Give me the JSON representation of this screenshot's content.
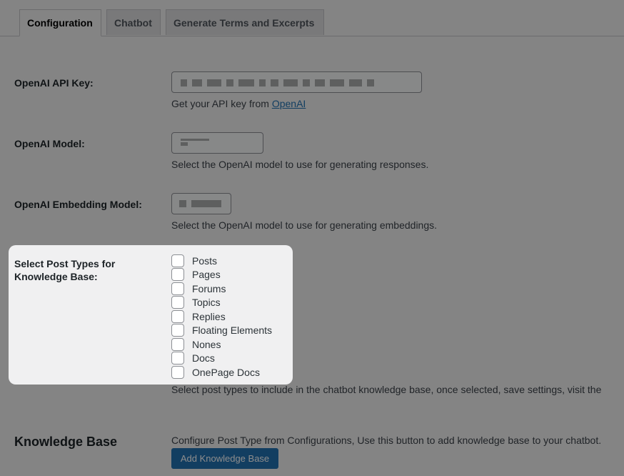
{
  "tabs": {
    "configuration": "Configuration",
    "chatbot": "Chatbot",
    "generate": "Generate Terms and Excerpts"
  },
  "api_key": {
    "label": "OpenAI API Key:",
    "desc_prefix": "Get your API key from ",
    "desc_link": "OpenAI"
  },
  "model": {
    "label": "OpenAI Model:",
    "desc": "Select the OpenAI model to use for generating responses."
  },
  "embedding": {
    "label": "OpenAI Embedding Model:",
    "desc": "Select the OpenAI model to use for generating embeddings."
  },
  "post_types": {
    "label": "Select Post Types for Knowledge Base:",
    "items": [
      "Posts",
      "Pages",
      "Forums",
      "Topics",
      "Replies",
      "Floating Elements",
      "Nones",
      "Docs",
      "OnePage Docs"
    ],
    "desc": "Select post types to include in the chatbot knowledge base, once selected, save settings, visit the"
  },
  "knowledge_base": {
    "title": "Knowledge Base",
    "desc": "Configure Post Type from Configurations, Use this button to add knowledge base to your chatbot.",
    "button": "Add Knowledge Base"
  },
  "colors": {
    "primary_button": "#2271b1",
    "link": "#2271b1"
  }
}
